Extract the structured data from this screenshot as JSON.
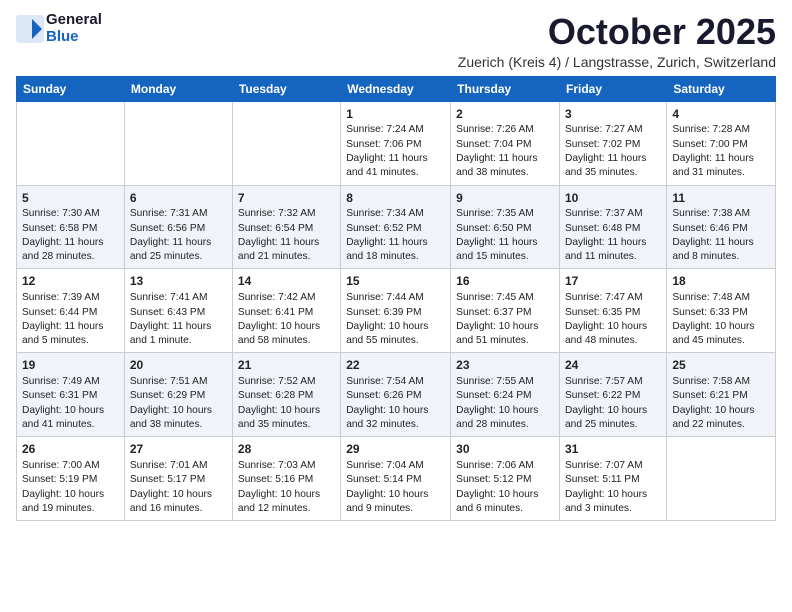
{
  "header": {
    "logo_general": "General",
    "logo_blue": "Blue",
    "month_title": "October 2025",
    "location": "Zuerich (Kreis 4) / Langstrasse, Zurich, Switzerland"
  },
  "days_of_week": [
    "Sunday",
    "Monday",
    "Tuesday",
    "Wednesday",
    "Thursday",
    "Friday",
    "Saturday"
  ],
  "weeks": [
    {
      "cells": [
        {
          "day": "",
          "info": ""
        },
        {
          "day": "",
          "info": ""
        },
        {
          "day": "",
          "info": ""
        },
        {
          "day": "1",
          "info": "Sunrise: 7:24 AM\nSunset: 7:06 PM\nDaylight: 11 hours\nand 41 minutes."
        },
        {
          "day": "2",
          "info": "Sunrise: 7:26 AM\nSunset: 7:04 PM\nDaylight: 11 hours\nand 38 minutes."
        },
        {
          "day": "3",
          "info": "Sunrise: 7:27 AM\nSunset: 7:02 PM\nDaylight: 11 hours\nand 35 minutes."
        },
        {
          "day": "4",
          "info": "Sunrise: 7:28 AM\nSunset: 7:00 PM\nDaylight: 11 hours\nand 31 minutes."
        }
      ]
    },
    {
      "cells": [
        {
          "day": "5",
          "info": "Sunrise: 7:30 AM\nSunset: 6:58 PM\nDaylight: 11 hours\nand 28 minutes."
        },
        {
          "day": "6",
          "info": "Sunrise: 7:31 AM\nSunset: 6:56 PM\nDaylight: 11 hours\nand 25 minutes."
        },
        {
          "day": "7",
          "info": "Sunrise: 7:32 AM\nSunset: 6:54 PM\nDaylight: 11 hours\nand 21 minutes."
        },
        {
          "day": "8",
          "info": "Sunrise: 7:34 AM\nSunset: 6:52 PM\nDaylight: 11 hours\nand 18 minutes."
        },
        {
          "day": "9",
          "info": "Sunrise: 7:35 AM\nSunset: 6:50 PM\nDaylight: 11 hours\nand 15 minutes."
        },
        {
          "day": "10",
          "info": "Sunrise: 7:37 AM\nSunset: 6:48 PM\nDaylight: 11 hours\nand 11 minutes."
        },
        {
          "day": "11",
          "info": "Sunrise: 7:38 AM\nSunset: 6:46 PM\nDaylight: 11 hours\nand 8 minutes."
        }
      ]
    },
    {
      "cells": [
        {
          "day": "12",
          "info": "Sunrise: 7:39 AM\nSunset: 6:44 PM\nDaylight: 11 hours\nand 5 minutes."
        },
        {
          "day": "13",
          "info": "Sunrise: 7:41 AM\nSunset: 6:43 PM\nDaylight: 11 hours\nand 1 minute."
        },
        {
          "day": "14",
          "info": "Sunrise: 7:42 AM\nSunset: 6:41 PM\nDaylight: 10 hours\nand 58 minutes."
        },
        {
          "day": "15",
          "info": "Sunrise: 7:44 AM\nSunset: 6:39 PM\nDaylight: 10 hours\nand 55 minutes."
        },
        {
          "day": "16",
          "info": "Sunrise: 7:45 AM\nSunset: 6:37 PM\nDaylight: 10 hours\nand 51 minutes."
        },
        {
          "day": "17",
          "info": "Sunrise: 7:47 AM\nSunset: 6:35 PM\nDaylight: 10 hours\nand 48 minutes."
        },
        {
          "day": "18",
          "info": "Sunrise: 7:48 AM\nSunset: 6:33 PM\nDaylight: 10 hours\nand 45 minutes."
        }
      ]
    },
    {
      "cells": [
        {
          "day": "19",
          "info": "Sunrise: 7:49 AM\nSunset: 6:31 PM\nDaylight: 10 hours\nand 41 minutes."
        },
        {
          "day": "20",
          "info": "Sunrise: 7:51 AM\nSunset: 6:29 PM\nDaylight: 10 hours\nand 38 minutes."
        },
        {
          "day": "21",
          "info": "Sunrise: 7:52 AM\nSunset: 6:28 PM\nDaylight: 10 hours\nand 35 minutes."
        },
        {
          "day": "22",
          "info": "Sunrise: 7:54 AM\nSunset: 6:26 PM\nDaylight: 10 hours\nand 32 minutes."
        },
        {
          "day": "23",
          "info": "Sunrise: 7:55 AM\nSunset: 6:24 PM\nDaylight: 10 hours\nand 28 minutes."
        },
        {
          "day": "24",
          "info": "Sunrise: 7:57 AM\nSunset: 6:22 PM\nDaylight: 10 hours\nand 25 minutes."
        },
        {
          "day": "25",
          "info": "Sunrise: 7:58 AM\nSunset: 6:21 PM\nDaylight: 10 hours\nand 22 minutes."
        }
      ]
    },
    {
      "cells": [
        {
          "day": "26",
          "info": "Sunrise: 7:00 AM\nSunset: 5:19 PM\nDaylight: 10 hours\nand 19 minutes."
        },
        {
          "day": "27",
          "info": "Sunrise: 7:01 AM\nSunset: 5:17 PM\nDaylight: 10 hours\nand 16 minutes."
        },
        {
          "day": "28",
          "info": "Sunrise: 7:03 AM\nSunset: 5:16 PM\nDaylight: 10 hours\nand 12 minutes."
        },
        {
          "day": "29",
          "info": "Sunrise: 7:04 AM\nSunset: 5:14 PM\nDaylight: 10 hours\nand 9 minutes."
        },
        {
          "day": "30",
          "info": "Sunrise: 7:06 AM\nSunset: 5:12 PM\nDaylight: 10 hours\nand 6 minutes."
        },
        {
          "day": "31",
          "info": "Sunrise: 7:07 AM\nSunset: 5:11 PM\nDaylight: 10 hours\nand 3 minutes."
        },
        {
          "day": "",
          "info": ""
        }
      ]
    }
  ]
}
